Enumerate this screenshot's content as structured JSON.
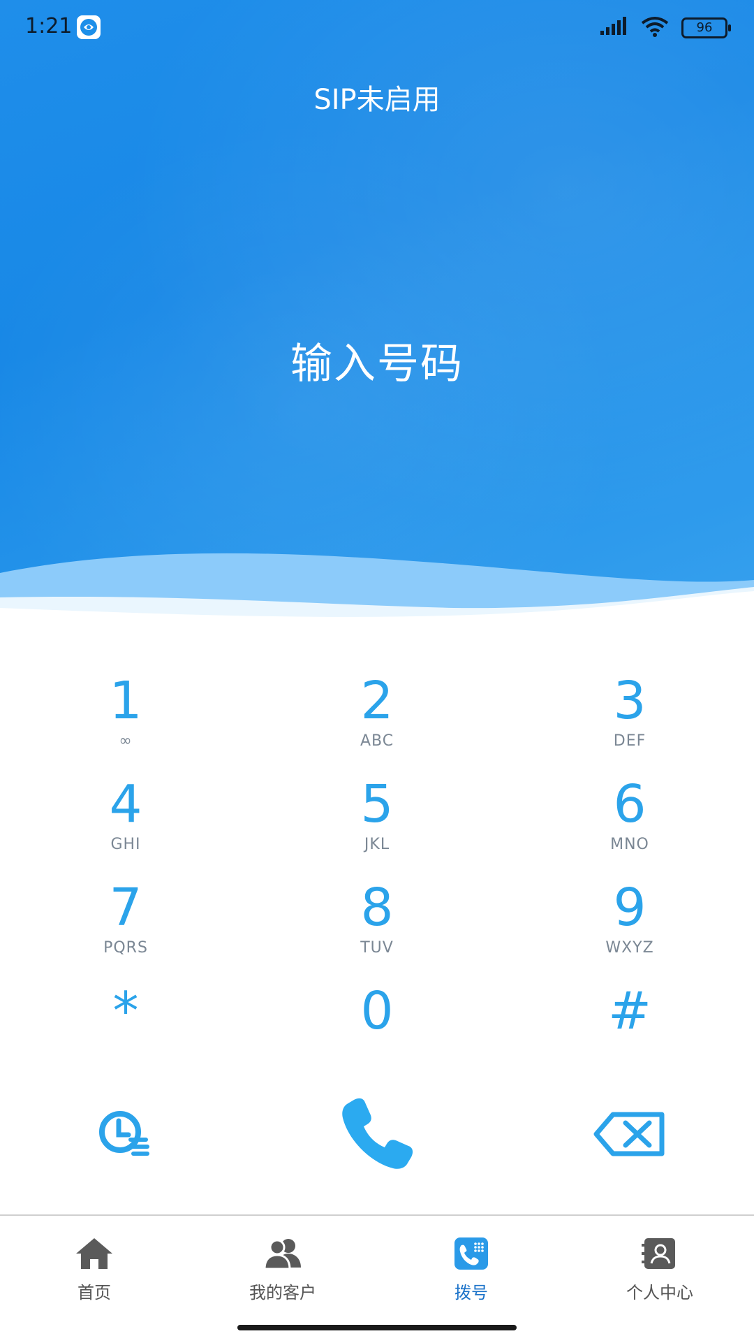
{
  "status_bar": {
    "time": "1:21",
    "battery": "96",
    "icons": [
      "app-badge-icon",
      "signal-icon",
      "wifi-icon",
      "battery-icon"
    ]
  },
  "header": {
    "sip_status": "SIP未启用",
    "number_placeholder": "输入号码"
  },
  "keypad": {
    "rows": [
      [
        {
          "digit": "1",
          "letters": "∞"
        },
        {
          "digit": "2",
          "letters": "ABC"
        },
        {
          "digit": "3",
          "letters": "DEF"
        }
      ],
      [
        {
          "digit": "4",
          "letters": "GHI"
        },
        {
          "digit": "5",
          "letters": "JKL"
        },
        {
          "digit": "6",
          "letters": "MNO"
        }
      ],
      [
        {
          "digit": "7",
          "letters": "PQRS"
        },
        {
          "digit": "8",
          "letters": "TUV"
        },
        {
          "digit": "9",
          "letters": "WXYZ"
        }
      ],
      [
        {
          "digit": "*",
          "letters": ""
        },
        {
          "digit": "0",
          "letters": ""
        },
        {
          "digit": "#",
          "letters": ""
        }
      ]
    ]
  },
  "actions": {
    "history_icon": "call-history-icon",
    "call_icon": "phone-icon",
    "delete_icon": "backspace-icon"
  },
  "tabbar": {
    "tabs": [
      {
        "label": "首页",
        "icon": "home-icon",
        "active": false
      },
      {
        "label": "我的客户",
        "icon": "customers-icon",
        "active": false
      },
      {
        "label": "拨号",
        "icon": "dialpad-icon",
        "active": true
      },
      {
        "label": "个人中心",
        "icon": "contact-card-icon",
        "active": false
      }
    ]
  },
  "colors": {
    "accent": "#2ba3ea",
    "header_blue": "#1888e6",
    "active_tab": "#1c73c9",
    "letters_gray": "#7b8794"
  }
}
